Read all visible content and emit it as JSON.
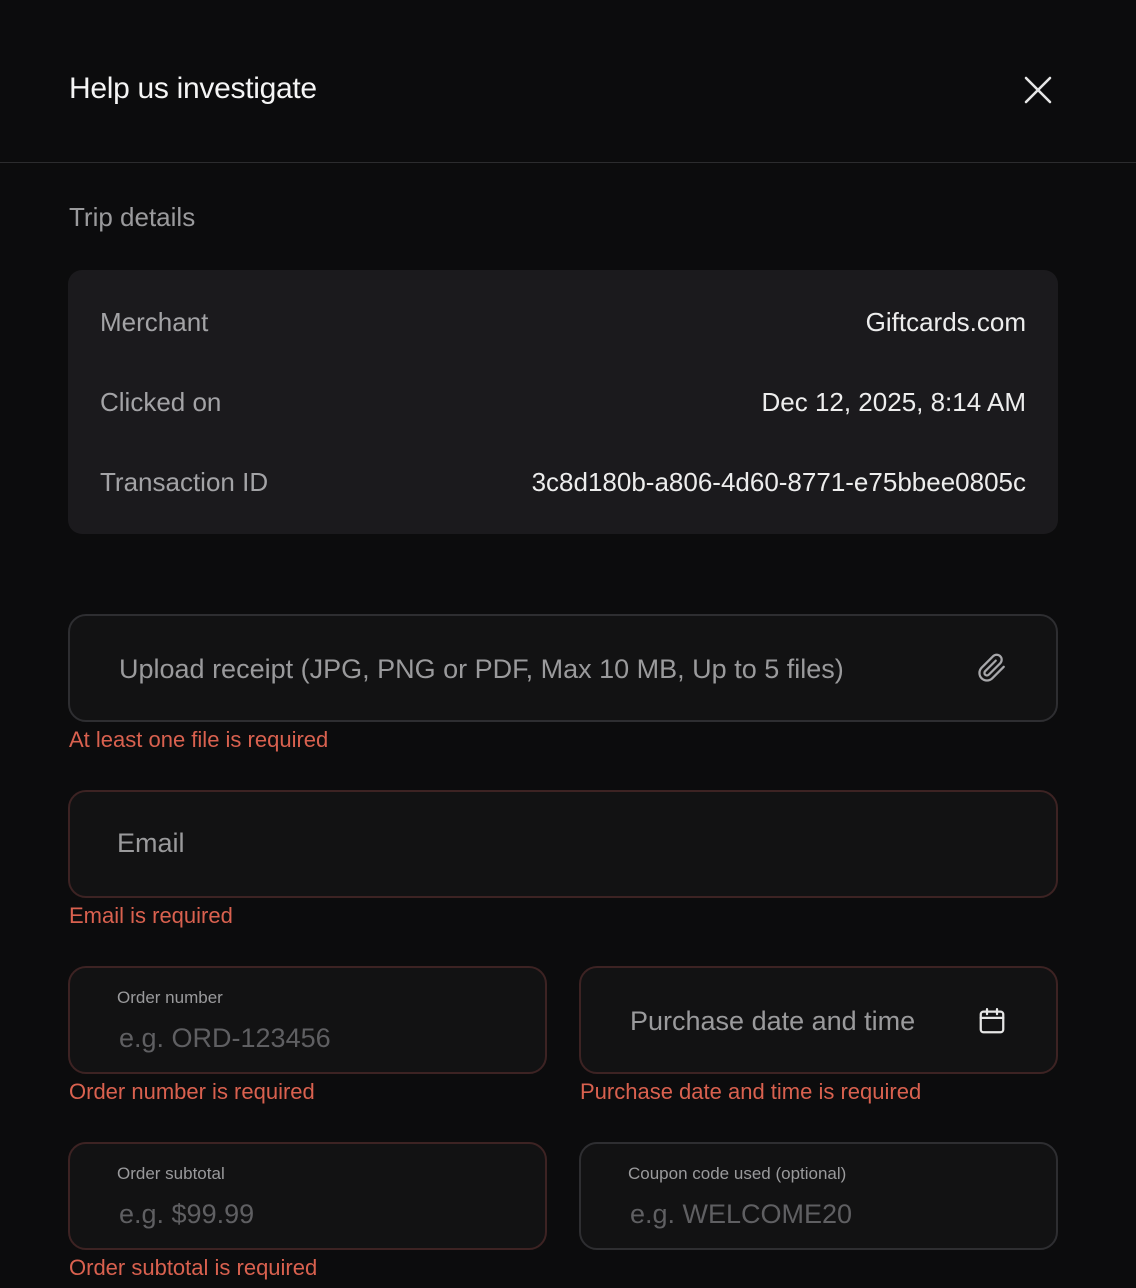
{
  "header": {
    "title": "Help us investigate",
    "close_icon": "close-icon"
  },
  "trip_details": {
    "label": "Trip details",
    "rows": [
      {
        "key": "Merchant",
        "value": "Giftcards.com"
      },
      {
        "key": "Clicked on",
        "value": "Dec 12, 2025, 8:14 AM"
      },
      {
        "key": "Transaction ID",
        "value": "3c8d180b-a806-4d60-8771-e75bbee0805c"
      }
    ]
  },
  "form": {
    "upload": {
      "placeholder": "Upload receipt (JPG, PNG or PDF, Max 10 MB, Up to 5 files)",
      "icon": "paperclip-icon",
      "error": "At least one file is required"
    },
    "email": {
      "placeholder": "Email",
      "error": "Email is required"
    },
    "order_number": {
      "label": "Order number",
      "placeholder": "e.g. ORD-123456",
      "error": "Order number is required"
    },
    "purchase_date": {
      "placeholder": "Purchase date and time",
      "icon": "calendar-icon",
      "error": "Purchase date and time is required"
    },
    "order_subtotal": {
      "label": "Order subtotal",
      "placeholder": "e.g. $99.99",
      "error": "Order subtotal is required"
    },
    "coupon": {
      "label": "Coupon code used (optional)",
      "placeholder": "e.g. WELCOME20"
    }
  },
  "colors": {
    "background": "#0c0c0d",
    "card": "#1b1a1d",
    "error_text": "#d9614f",
    "error_border": "#3d2323"
  }
}
